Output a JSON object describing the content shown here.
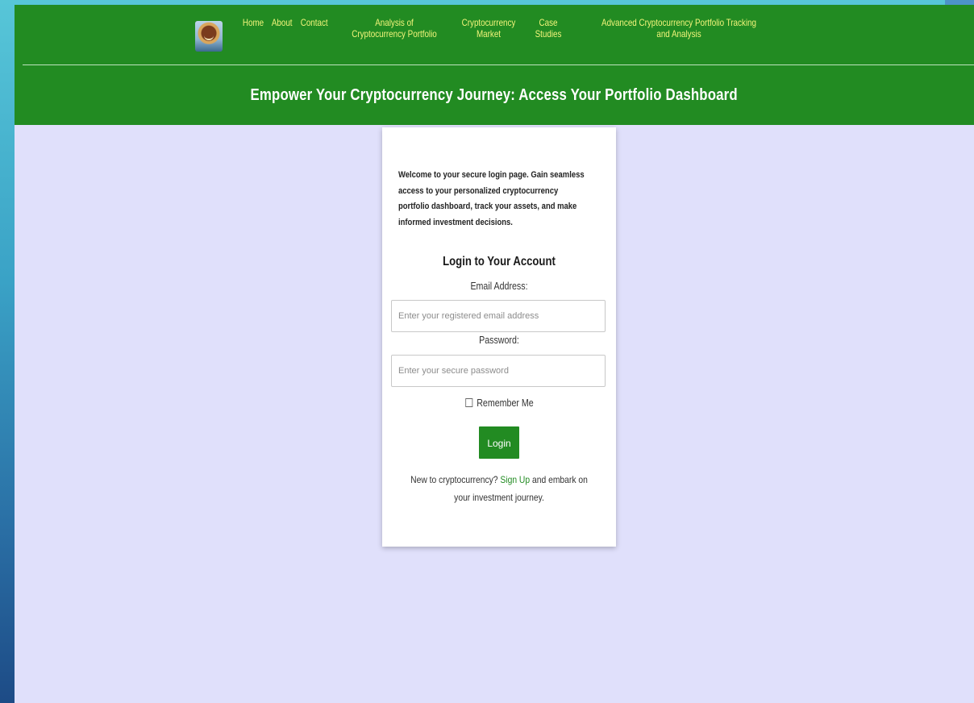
{
  "nav": {
    "logo_icon": "profile-photo",
    "links": [
      {
        "label": "Home"
      },
      {
        "label": "About"
      },
      {
        "label": "Contact"
      },
      {
        "label": "Analysis of Cryptocurrency Portfolio"
      },
      {
        "label": "Cryptocurrency Market"
      },
      {
        "label": "Case Studies"
      },
      {
        "label": "Advanced Cryptocurrency Portfolio Tracking and Analysis"
      }
    ]
  },
  "banner": {
    "title": "Empower Your Cryptocurrency Journey: Access Your Portfolio Dashboard"
  },
  "login": {
    "welcome": "Welcome to your secure login page. Gain seamless access to your personalized cryptocurrency portfolio dashboard, track your assets, and make informed investment decisions.",
    "title": "Login to Your Account",
    "email_label": "Email Address:",
    "email_placeholder": "Enter your registered email address",
    "password_label": "Password:",
    "password_placeholder": "Enter your secure password",
    "remember_label": "Remember Me",
    "button_label": "Login",
    "signup_prefix": "New to cryptocurrency?",
    "signup_link": "Sign Up",
    "signup_suffix": "and embark on your investment journey."
  },
  "colors": {
    "header_green": "#228b22",
    "nav_link_yellow": "#f3f57a",
    "page_background": "#e0e0fb",
    "card_background": "#ffffff"
  }
}
